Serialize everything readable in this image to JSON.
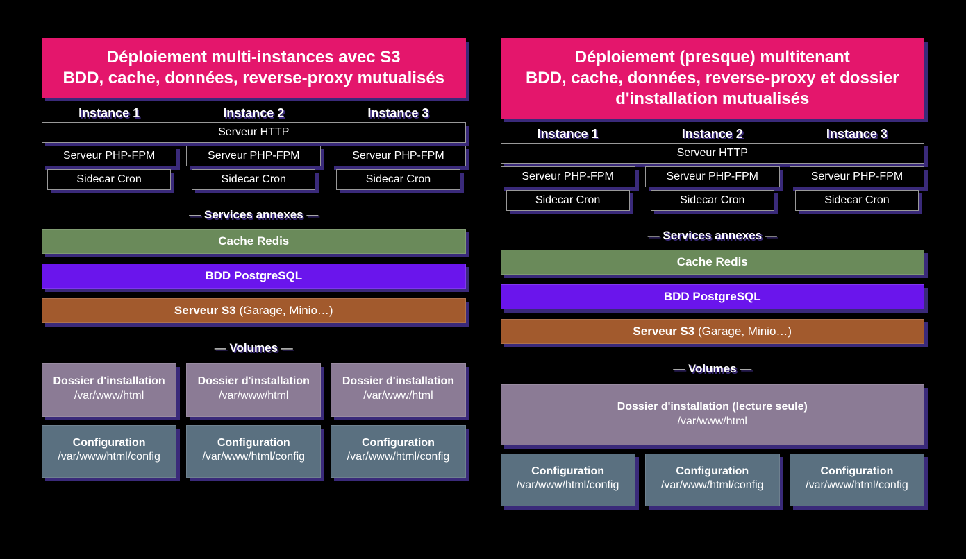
{
  "left": {
    "title_line1": "Déploiement multi-instances avec S3",
    "title_line2": "BDD, cache, données, reverse-proxy mutualisés",
    "instances": [
      "Instance 1",
      "Instance 2",
      "Instance 3"
    ],
    "http": "Serveur HTTP",
    "php": "Serveur PHP-FPM",
    "cron": "Sidecar Cron",
    "section_services": "Services annexes",
    "redis": "Cache Redis",
    "pg": "BDD PostgreSQL",
    "s3_bold": "Serveur S3",
    "s3_rest": " (Garage, Minio…)",
    "section_volumes": "Volumes",
    "install_title": "Dossier d'installation",
    "install_path": "/var/www/html",
    "config_title": "Configuration",
    "config_path": "/var/www/html/config"
  },
  "right": {
    "title_line1": "Déploiement (presque) multitenant",
    "title_line2": "BDD, cache, données, reverse-proxy et dossier d'installation mutualisés",
    "instances": [
      "Instance 1",
      "Instance 2",
      "Instance 3"
    ],
    "http": "Serveur HTTP",
    "php": "Serveur PHP-FPM",
    "cron": "Sidecar Cron",
    "section_services": "Services annexes",
    "redis": "Cache Redis",
    "pg": "BDD PostgreSQL",
    "s3_bold": "Serveur S3",
    "s3_rest": " (Garage, Minio…)",
    "section_volumes": "Volumes",
    "install_title": "Dossier d'installation (lecture seule)",
    "install_path": "/var/www/html",
    "config_title": "Configuration",
    "config_path": "/var/www/html/config"
  }
}
